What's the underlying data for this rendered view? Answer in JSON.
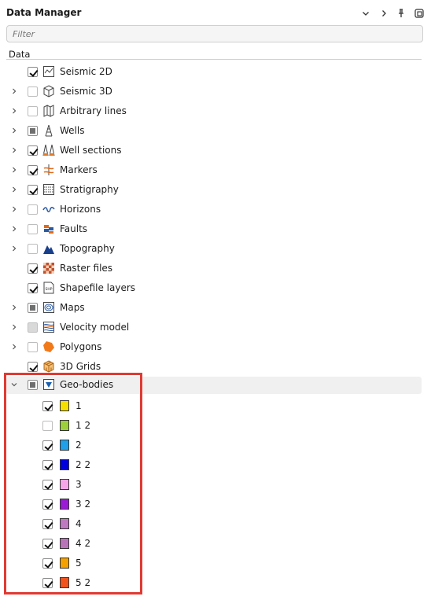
{
  "panel": {
    "title": "Data Manager",
    "column_header": "Data",
    "filter_placeholder": "Filter"
  },
  "tree": [
    {
      "label": "Seismic 2D",
      "state": "checked",
      "expander": false,
      "icon": "seismic-2d-icon"
    },
    {
      "label": "Seismic 3D",
      "state": "unchecked",
      "expander": true,
      "icon": "seismic-3d-icon"
    },
    {
      "label": "Arbitrary lines",
      "state": "unchecked",
      "expander": true,
      "icon": "arbitrary-lines-icon"
    },
    {
      "label": "Wells",
      "state": "partial",
      "expander": true,
      "icon": "well-icon"
    },
    {
      "label": "Well sections",
      "state": "checked",
      "expander": true,
      "icon": "well-sections-icon"
    },
    {
      "label": "Markers",
      "state": "checked",
      "expander": true,
      "icon": "markers-icon"
    },
    {
      "label": "Stratigraphy",
      "state": "checked",
      "expander": true,
      "icon": "stratigraphy-icon"
    },
    {
      "label": "Horizons",
      "state": "unchecked",
      "expander": true,
      "icon": "horizons-icon"
    },
    {
      "label": "Faults",
      "state": "unchecked",
      "expander": true,
      "icon": "faults-icon"
    },
    {
      "label": "Topography",
      "state": "unchecked",
      "expander": true,
      "icon": "topography-icon"
    },
    {
      "label": "Raster files",
      "state": "checked",
      "expander": false,
      "icon": "raster-files-icon"
    },
    {
      "label": "Shapefile layers",
      "state": "checked",
      "expander": false,
      "icon": "shapefile-icon"
    },
    {
      "label": "Maps",
      "state": "partial",
      "expander": true,
      "icon": "maps-icon"
    },
    {
      "label": "Velocity model",
      "state": "disabled",
      "expander": true,
      "icon": "velocity-model-icon"
    },
    {
      "label": "Polygons",
      "state": "unchecked",
      "expander": true,
      "icon": "polygons-icon"
    },
    {
      "label": "3D Grids",
      "state": "checked",
      "expander": false,
      "icon": "grids-3d-icon"
    }
  ],
  "geobodies": {
    "label": "Geo-bodies",
    "state": "partial",
    "expanded": true,
    "icon": "geo-bodies-icon",
    "children": [
      {
        "label": "1",
        "checked": true,
        "color": "#f5e000"
      },
      {
        "label": "1 2",
        "checked": false,
        "color": "#9ccf3a"
      },
      {
        "label": "2",
        "checked": true,
        "color": "#1fa0e8"
      },
      {
        "label": "2 2",
        "checked": true,
        "color": "#0000dd"
      },
      {
        "label": "3",
        "checked": true,
        "color": "#f6a6e8"
      },
      {
        "label": "3 2",
        "checked": true,
        "color": "#9a1ad6"
      },
      {
        "label": "4",
        "checked": true,
        "color": "#bf79c0"
      },
      {
        "label": "4 2",
        "checked": true,
        "color": "#b974b9"
      },
      {
        "label": "5",
        "checked": true,
        "color": "#f5a100"
      },
      {
        "label": "5 2",
        "checked": true,
        "color": "#f0531c"
      }
    ]
  },
  "colors": {
    "highlight_box": "#e03a33",
    "selected_row_bg": "#f0f0f0"
  }
}
